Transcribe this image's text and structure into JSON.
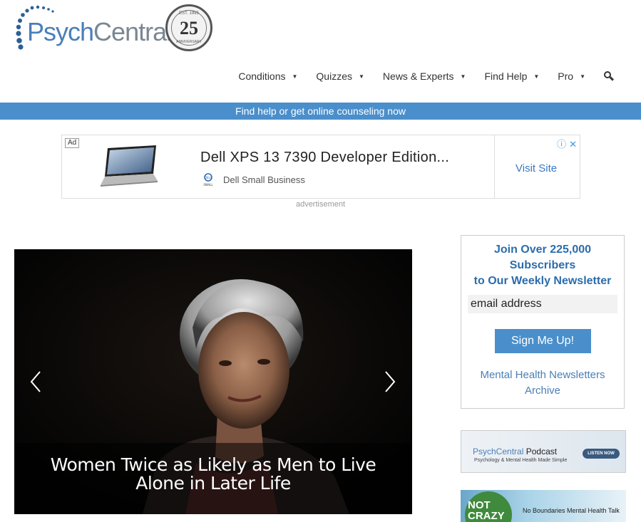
{
  "header": {
    "logo": {
      "psych": "Psych",
      "central": "Central",
      "reg": "®",
      "anniversary_number": "25",
      "est": "EST. 1995",
      "anniversary_word": "ANNIVERSARY"
    },
    "nav": [
      {
        "label": "Conditions"
      },
      {
        "label": "Quizzes"
      },
      {
        "label": "News & Experts"
      },
      {
        "label": "Find Help"
      },
      {
        "label": "Pro"
      }
    ],
    "search_icon": "search-icon"
  },
  "help_bar": {
    "label": "Find help or get online counseling now"
  },
  "ad": {
    "tag": "Ad",
    "title": "Dell XPS 13 7390 Developer Edition...",
    "brand": "Dell Small Business",
    "brand_logo_text": "SMALL",
    "visit_label": "Visit Site",
    "caption": "advertisement"
  },
  "hero": {
    "title_line1": "Women Twice as Likely as Men to Live",
    "title_line2": "Alone in Later Life"
  },
  "sidebar": {
    "newsletter": {
      "title_line1": "Join Over 225,000",
      "title_line2": "Subscribers",
      "title_line3": "to Our Weekly Newsletter",
      "input_value": "email address",
      "button_label": "Sign Me Up!",
      "archive_line1": "Mental Health Newsletters",
      "archive_line2": "Archive"
    },
    "podcast": {
      "name_brand": "PsychCentral",
      "name_suffix": "Podcast",
      "tagline": "Psychology & Mental Health Made Simple",
      "button": "LISTEN NOW"
    },
    "notcrazy": {
      "line1": "NOT",
      "line2": "CRAZY",
      "tagline": "No Boundaries Mental Health Talk"
    }
  },
  "colors": {
    "accent": "#4a8fcb",
    "brand_blue": "#4a7fb8",
    "nav_text": "#333333"
  }
}
